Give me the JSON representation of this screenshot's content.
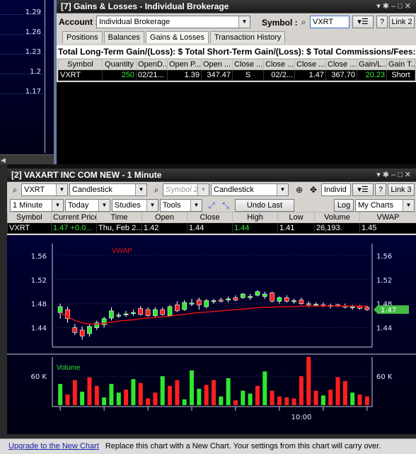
{
  "mini_chart": {
    "ticks": [
      "1.29",
      "1.26",
      "1.23",
      "1.2",
      "1.17"
    ]
  },
  "gains_window": {
    "title": "[7] Gains & Losses - Individual Brokerage",
    "account_label": "Account :",
    "account_value": "Individual Brokerage",
    "symbol_label": "Symbol :",
    "symbol_value": "VXRT",
    "link_label": "Link 2",
    "help_label": "?",
    "tabs": [
      "Positions",
      "Balances",
      "Gains & Losses",
      "Transaction History"
    ],
    "active_tab": 2,
    "summary": "Total Long-Term Gain/(Loss): $ Total Short-Term Gain/(Loss): $ Total Commissions/Fees: $ T",
    "columns": [
      "Symbol",
      "Quantity",
      "OpenD...",
      "Open P...",
      "Open ...",
      "Close ...",
      "Close ...",
      "Close ...",
      "Close ...",
      "Gain/L...",
      "Gain T..."
    ],
    "rows": [
      [
        "VXRT",
        "250",
        "02/21...",
        "1.39",
        "347.47",
        "S",
        "02/2...",
        "1.47",
        "367.70",
        "20.23",
        "Short"
      ]
    ]
  },
  "chart_window": {
    "title": "[2] VAXART INC COM NEW - 1 Minute",
    "symbol": "VXRT",
    "chart_type": "Candlestick",
    "symbol2_placeholder": "Symbol 2",
    "chart_type2": "Candlestick",
    "individ_label": "Individ",
    "link_label": "Link 3",
    "help_label": "?",
    "interval": "1 Minute",
    "range": "Today",
    "studies": "Studies",
    "tools": "Tools",
    "undo": "Undo Last",
    "log": "Log",
    "my_charts": "My Charts",
    "quote_columns": [
      "Symbol",
      "Current Price",
      "Time",
      "Open",
      "Close",
      "High",
      "Low",
      "Volume",
      "VWAP"
    ],
    "quote_row": [
      "VXRT",
      "1.47  +0.0...",
      "Thu, Feb 2...",
      "1.42",
      "1.44",
      "1.44",
      "1.41",
      "26,193.",
      "1.45"
    ],
    "colors": {
      "up": "#2ee82e",
      "down": "#ff1f1f",
      "vwap": "#e01010",
      "price_tag": "#44bb44"
    }
  },
  "chart_data": [
    {
      "type": "candlestick",
      "title": "",
      "legend": [
        "VWAP"
      ],
      "y_ticks": [
        "1.56",
        "1.52",
        "1.48",
        "1.44"
      ],
      "ylim": [
        1.41,
        1.58
      ],
      "current_price_label": "1.47",
      "candles": [
        {
          "o": 1.465,
          "c": 1.475,
          "h": 1.48,
          "l": 1.455,
          "up": true
        },
        {
          "o": 1.47,
          "c": 1.455,
          "h": 1.475,
          "l": 1.448,
          "up": false
        },
        {
          "o": 1.44,
          "c": 1.432,
          "h": 1.446,
          "l": 1.428,
          "up": false
        },
        {
          "o": 1.436,
          "c": 1.426,
          "h": 1.442,
          "l": 1.42,
          "up": false
        },
        {
          "o": 1.43,
          "c": 1.442,
          "h": 1.446,
          "l": 1.425,
          "up": true
        },
        {
          "o": 1.44,
          "c": 1.448,
          "h": 1.452,
          "l": 1.436,
          "up": true
        },
        {
          "o": 1.445,
          "c": 1.455,
          "h": 1.458,
          "l": 1.44,
          "up": true
        },
        {
          "o": 1.456,
          "c": 1.468,
          "h": 1.474,
          "l": 1.452,
          "up": true
        },
        {
          "o": 1.46,
          "c": 1.461,
          "h": 1.465,
          "l": 1.456,
          "up": true
        },
        {
          "o": 1.462,
          "c": 1.463,
          "h": 1.468,
          "l": 1.458,
          "up": true
        },
        {
          "o": 1.464,
          "c": 1.465,
          "h": 1.47,
          "l": 1.46,
          "up": true
        },
        {
          "o": 1.472,
          "c": 1.462,
          "h": 1.476,
          "l": 1.46,
          "up": false
        },
        {
          "o": 1.47,
          "c": 1.46,
          "h": 1.474,
          "l": 1.458,
          "up": false
        },
        {
          "o": 1.46,
          "c": 1.47,
          "h": 1.474,
          "l": 1.456,
          "up": true
        },
        {
          "o": 1.47,
          "c": 1.462,
          "h": 1.474,
          "l": 1.46,
          "up": false
        },
        {
          "o": 1.46,
          "c": 1.475,
          "h": 1.478,
          "l": 1.458,
          "up": true
        },
        {
          "o": 1.478,
          "c": 1.468,
          "h": 1.484,
          "l": 1.466,
          "up": false
        },
        {
          "o": 1.47,
          "c": 1.482,
          "h": 1.486,
          "l": 1.468,
          "up": true
        },
        {
          "o": 1.48,
          "c": 1.481,
          "h": 1.488,
          "l": 1.476,
          "up": true
        },
        {
          "o": 1.486,
          "c": 1.478,
          "h": 1.49,
          "l": 1.47,
          "up": false
        },
        {
          "o": 1.475,
          "c": 1.485,
          "h": 1.488,
          "l": 1.472,
          "up": true
        },
        {
          "o": 1.484,
          "c": 1.485,
          "h": 1.488,
          "l": 1.48,
          "up": true
        },
        {
          "o": 1.486,
          "c": 1.484,
          "h": 1.49,
          "l": 1.482,
          "up": false
        },
        {
          "o": 1.486,
          "c": 1.488,
          "h": 1.492,
          "l": 1.482,
          "up": true
        },
        {
          "o": 1.49,
          "c": 1.486,
          "h": 1.494,
          "l": 1.484,
          "up": false
        },
        {
          "o": 1.49,
          "c": 1.496,
          "h": 1.498,
          "l": 1.488,
          "up": true
        },
        {
          "o": 1.49,
          "c": 1.492,
          "h": 1.496,
          "l": 1.486,
          "up": true
        },
        {
          "o": 1.494,
          "c": 1.5,
          "h": 1.502,
          "l": 1.492,
          "up": true
        },
        {
          "o": 1.492,
          "c": 1.496,
          "h": 1.5,
          "l": 1.488,
          "up": true
        },
        {
          "o": 1.498,
          "c": 1.484,
          "h": 1.5,
          "l": 1.482,
          "up": false
        },
        {
          "o": 1.484,
          "c": 1.49,
          "h": 1.492,
          "l": 1.48,
          "up": true
        },
        {
          "o": 1.49,
          "c": 1.484,
          "h": 1.494,
          "l": 1.482,
          "up": false
        },
        {
          "o": 1.484,
          "c": 1.485,
          "h": 1.488,
          "l": 1.48,
          "up": true
        },
        {
          "o": 1.486,
          "c": 1.48,
          "h": 1.49,
          "l": 1.478,
          "up": false
        },
        {
          "o": 1.48,
          "c": 1.478,
          "h": 1.484,
          "l": 1.474,
          "up": false
        },
        {
          "o": 1.478,
          "c": 1.479,
          "h": 1.482,
          "l": 1.475,
          "up": true
        },
        {
          "o": 1.478,
          "c": 1.476,
          "h": 1.482,
          "l": 1.474,
          "up": false
        },
        {
          "o": 1.476,
          "c": 1.477,
          "h": 1.48,
          "l": 1.472,
          "up": true
        },
        {
          "o": 1.478,
          "c": 1.476,
          "h": 1.48,
          "l": 1.474,
          "up": false
        },
        {
          "o": 1.476,
          "c": 1.474,
          "h": 1.48,
          "l": 1.472,
          "up": false
        },
        {
          "o": 1.474,
          "c": 1.475,
          "h": 1.478,
          "l": 1.47,
          "up": true
        },
        {
          "o": 1.476,
          "c": 1.472,
          "h": 1.478,
          "l": 1.47,
          "up": false
        },
        {
          "o": 1.474,
          "c": 1.47,
          "h": 1.476,
          "l": 1.468,
          "up": false
        }
      ],
      "vwap": [
        1.465,
        1.458,
        1.452,
        1.448,
        1.446,
        1.446,
        1.447,
        1.449,
        1.451,
        1.452,
        1.453,
        1.455,
        1.456,
        1.457,
        1.458,
        1.459,
        1.461,
        1.462,
        1.464,
        1.465,
        1.466,
        1.467,
        1.468,
        1.469,
        1.47,
        1.471,
        1.472,
        1.473,
        1.474,
        1.474,
        1.475,
        1.475,
        1.475,
        1.476,
        1.476,
        1.476,
        1.476,
        1.476,
        1.476,
        1.476,
        1.476,
        1.476,
        1.476
      ]
    },
    {
      "type": "bar",
      "title": "",
      "legend": [
        "Volume"
      ],
      "y_ticks": [
        "60 K"
      ],
      "ylim": [
        0,
        100000
      ],
      "x_ticks": [
        "10:00"
      ],
      "values": [
        44000,
        22000,
        52000,
        28000,
        58000,
        40000,
        16000,
        44000,
        26000,
        32000,
        54000,
        46000,
        14000,
        26000,
        60000,
        40000,
        52000,
        12000,
        72000,
        34000,
        42000,
        52000,
        18000,
        56000,
        10000,
        30000,
        24000,
        40000,
        70000,
        30000,
        18000,
        16000,
        14000,
        60000,
        100000,
        30000,
        20000,
        32000,
        58000,
        50000,
        26000,
        22000,
        18000
      ],
      "up": [
        true,
        false,
        false,
        true,
        false,
        false,
        true,
        true,
        true,
        false,
        true,
        false,
        false,
        false,
        true,
        false,
        false,
        true,
        true,
        true,
        false,
        false,
        true,
        true,
        false,
        true,
        true,
        false,
        true,
        false,
        false,
        false,
        false,
        false,
        false,
        false,
        true,
        false,
        false,
        false,
        true,
        false,
        false
      ]
    }
  ],
  "footer": {
    "link": "Upgrade to the New Chart",
    "text": "Replace this chart with a New Chart. Your settings from this chart will carry over."
  }
}
